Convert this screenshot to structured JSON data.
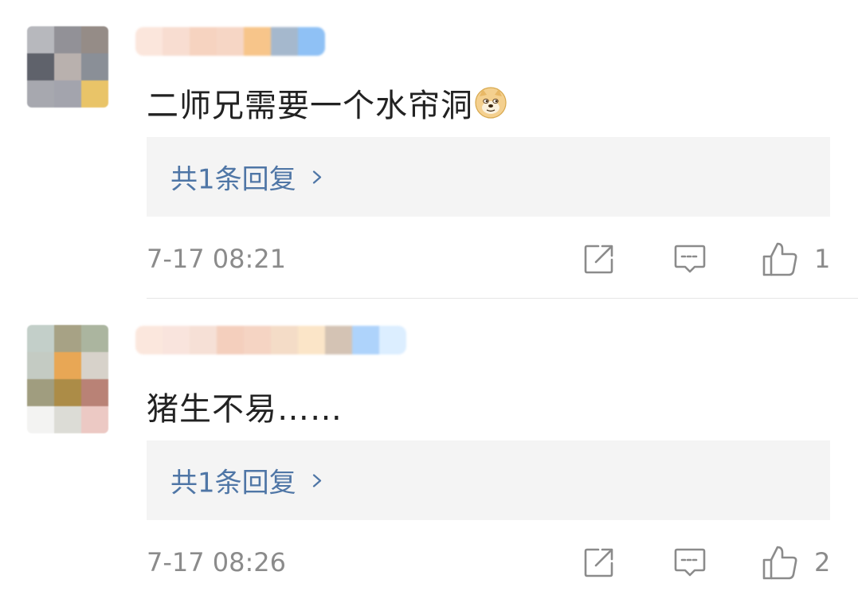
{
  "comments": [
    {
      "avatar_colors": [
        "#b7b8bd",
        "#929197",
        "#958c87",
        "#5f626b",
        "#b9b1ae",
        "#8a8f97",
        "#a7a8af",
        "#a3a4ad",
        "#e9c468"
      ],
      "name_colors": [
        "#fbe6dc",
        "#f8ddd1",
        "#f6d3c0",
        "#f6d6c5",
        "#f7c58a",
        "#a5b8cd",
        "#8fc1f5"
      ],
      "text": "二师兄需要一个水帘洞",
      "emoji": "doge-icon",
      "reply_label": "共1条回复",
      "time": "7-17 08:21",
      "like_count": "1"
    },
    {
      "avatar_colors": [
        "#c3cfc9",
        "#a7a285",
        "#abb59f",
        "#c4cbc3",
        "#e8a755",
        "#d7d2ca",
        "#a09d7f",
        "#ac8c47",
        "#b98276",
        "#f3f3f2",
        "#dcdcd6",
        "#ecc9c4"
      ],
      "name_colors": [
        "#fbe7dd",
        "#f9e4dd",
        "#f6e0d6",
        "#f4cfbd",
        "#f5d4c3",
        "#f4dcc7",
        "#fbe5c8",
        "#d4c3b4",
        "#aed3fb",
        "#dceeff"
      ],
      "text": "猪生不易……",
      "reply_label": "共1条回复",
      "time": "7-17 08:26",
      "like_count": "2"
    }
  ],
  "colors": {
    "reply_link": "#4f76a6",
    "icon_gray": "#8b8b8b",
    "reply_bg": "#f4f4f4"
  },
  "icons": [
    "share-icon",
    "comment-icon",
    "thumbs-up-icon",
    "chevron-right-icon",
    "doge-icon"
  ]
}
